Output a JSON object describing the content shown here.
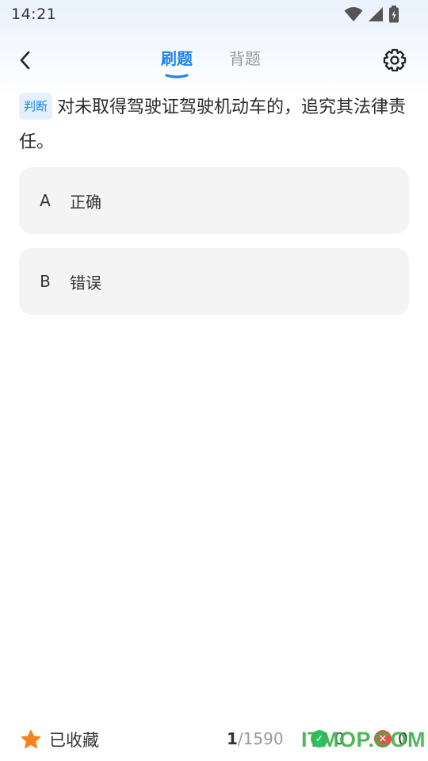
{
  "status_bar": {
    "time": "14:21",
    "icons": [
      "wifi-icon",
      "signal-icon",
      "battery-icon"
    ]
  },
  "header": {
    "back_icon": "chevron-left-icon",
    "tabs": [
      {
        "label": "刷题",
        "active": true
      },
      {
        "label": "背题",
        "active": false
      }
    ],
    "settings_icon": "gear-icon"
  },
  "question": {
    "type": "判断",
    "text": "对未取得驾驶证驾驶机动车的，追究其法律责任。"
  },
  "options": [
    {
      "letter": "A",
      "text": "正确"
    },
    {
      "letter": "B",
      "text": "错误"
    }
  ],
  "bottom_bar": {
    "favorite_label": "已收藏",
    "progress_current": "1",
    "progress_total": "/1590",
    "correct_count": "0",
    "wrong_count": "0"
  },
  "watermark": "ITMOP.COM",
  "colors": {
    "accent": "#1a84f2",
    "star": "#f7821b",
    "correct": "#27c46a",
    "wrong": "#f04a4a",
    "option_bg": "#f4f4f4"
  }
}
